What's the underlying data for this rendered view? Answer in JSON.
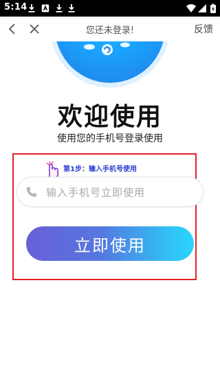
{
  "status_bar": {
    "time": "5:14",
    "icons": [
      "download-icon",
      "text-notification-icon",
      "download-icon",
      "download-icon"
    ],
    "right_icons": [
      "wifi-icon",
      "signal-icon",
      "battery-charging-icon"
    ]
  },
  "nav": {
    "title": "您还未登录!",
    "feedback_label": "反馈"
  },
  "hero": {
    "colors": {
      "primary": "#1aa6ff",
      "ring": "#dff1ff"
    }
  },
  "welcome": {
    "title": "欢迎使用",
    "subtitle": "使用您的手机号登录使用"
  },
  "step_hint": "第1步：输入手机号使用",
  "phone_input": {
    "value": "",
    "placeholder": "输入手机号立即使用"
  },
  "use_button_label": "立即使用",
  "colors": {
    "highlight_border": "#e5202a",
    "step_hint": "#2a3fd0",
    "button_gradient_start": "#6a5fd6",
    "button_gradient_end": "#2ad6fb"
  }
}
